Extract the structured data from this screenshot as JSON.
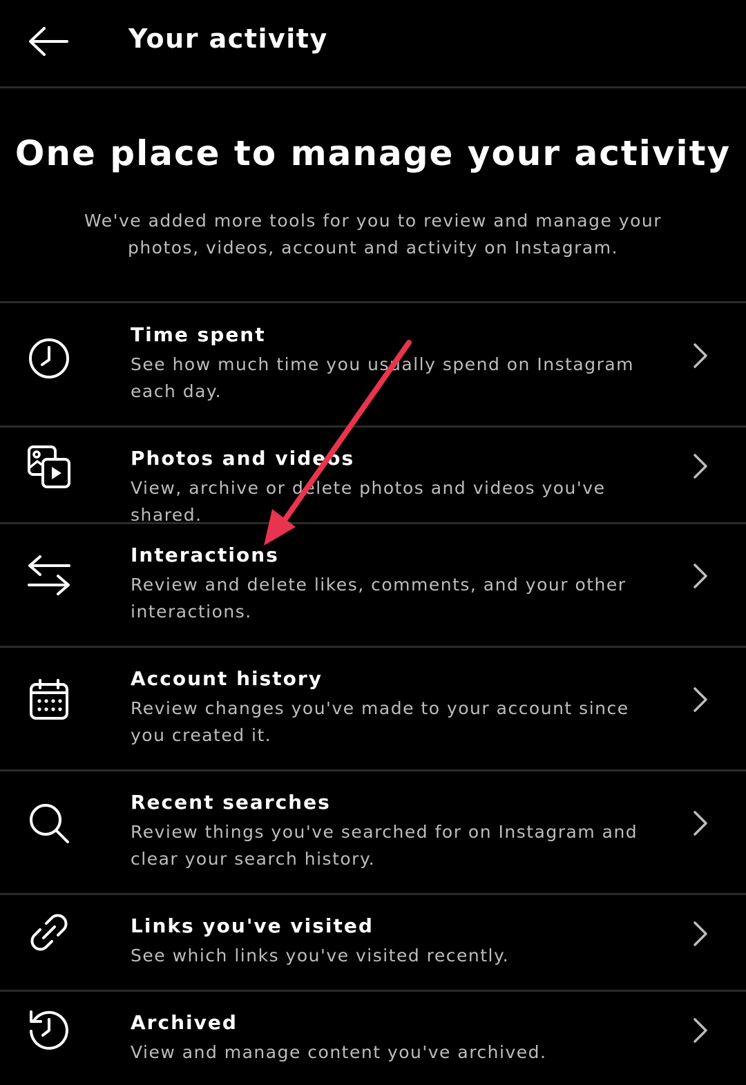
{
  "header": {
    "title": "Your activity",
    "back_icon": "arrow-left-icon"
  },
  "intro": {
    "heading": "One place to manage your activity",
    "description": "We've added more tools for you to review and manage your photos, videos, account and activity on Instagram."
  },
  "items": [
    {
      "title": "Time spent",
      "description": "See how much time you usually spend on Instagram each day.",
      "icon": "clock-icon"
    },
    {
      "title": "Photos and videos",
      "description": "View, archive or delete photos and videos you've shared.",
      "icon": "photos-videos-icon"
    },
    {
      "title": "Interactions",
      "description": "Review and delete likes, comments, and your other interactions.",
      "icon": "interactions-arrows-icon"
    },
    {
      "title": "Account history",
      "description": "Review changes you've made to your account since you created it.",
      "icon": "calendar-icon"
    },
    {
      "title": "Recent searches",
      "description": "Review things you've searched for on Instagram and clear your search history.",
      "icon": "search-icon"
    },
    {
      "title": "Links you've visited",
      "description": "See which links you've visited recently.",
      "icon": "link-icon"
    },
    {
      "title": "Archived",
      "description": "View and manage content you've archived.",
      "icon": "archive-history-icon"
    }
  ],
  "colors": {
    "background": "#000000",
    "text_primary": "#ffffff",
    "text_secondary": "#bdbdbd",
    "divider": "#2b2b2b",
    "annotation_arrow": "#e8344e"
  }
}
